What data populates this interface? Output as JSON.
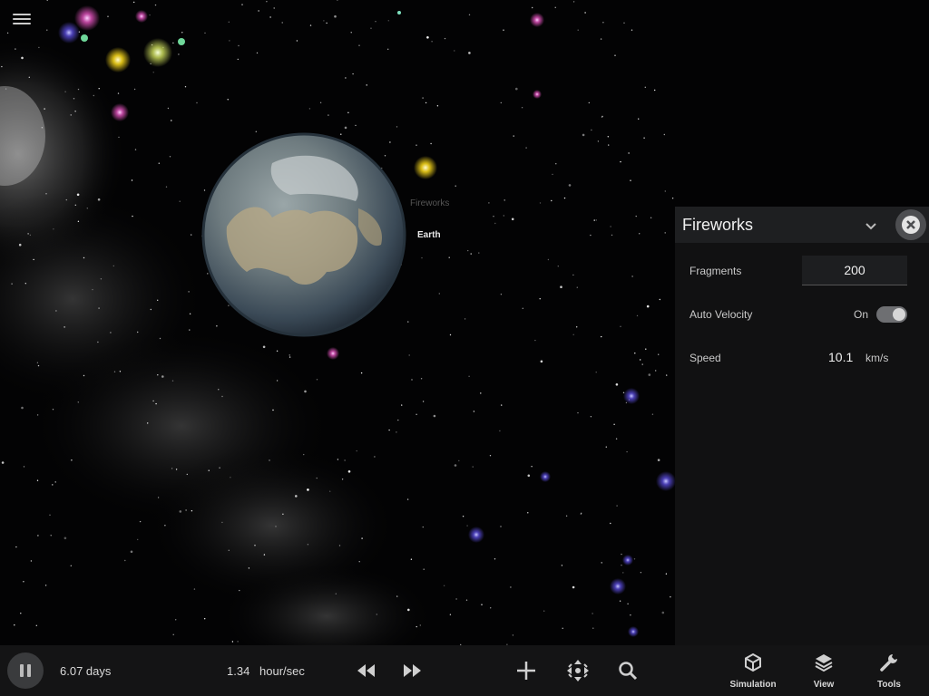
{
  "labels": {
    "fireworks": "Fireworks",
    "earth": "Earth"
  },
  "panel": {
    "title": "Fireworks",
    "rows": {
      "fragments_label": "Fragments",
      "fragments_value": "200",
      "auto_velocity_label": "Auto Velocity",
      "auto_velocity_state": "On",
      "speed_label": "Speed",
      "speed_value": "10.1",
      "speed_unit": "km/s"
    }
  },
  "bottombar": {
    "elapsed": "6.07 days",
    "rate_value": "1.34",
    "rate_unit": "hour/sec",
    "tabs": [
      {
        "label": "Simulation",
        "icon": "cube-icon"
      },
      {
        "label": "View",
        "icon": "layers-icon"
      },
      {
        "label": "Tools",
        "icon": "wrench-icon"
      }
    ]
  },
  "icons": {
    "menu": "hamburger-icon",
    "collapse": "chevron-down-icon",
    "close": "close-icon",
    "pause": "pause-icon",
    "rewind": "rewind-icon",
    "fast_forward": "fast-forward-icon",
    "add": "plus-icon",
    "center": "center-view-icon",
    "search": "search-icon"
  }
}
